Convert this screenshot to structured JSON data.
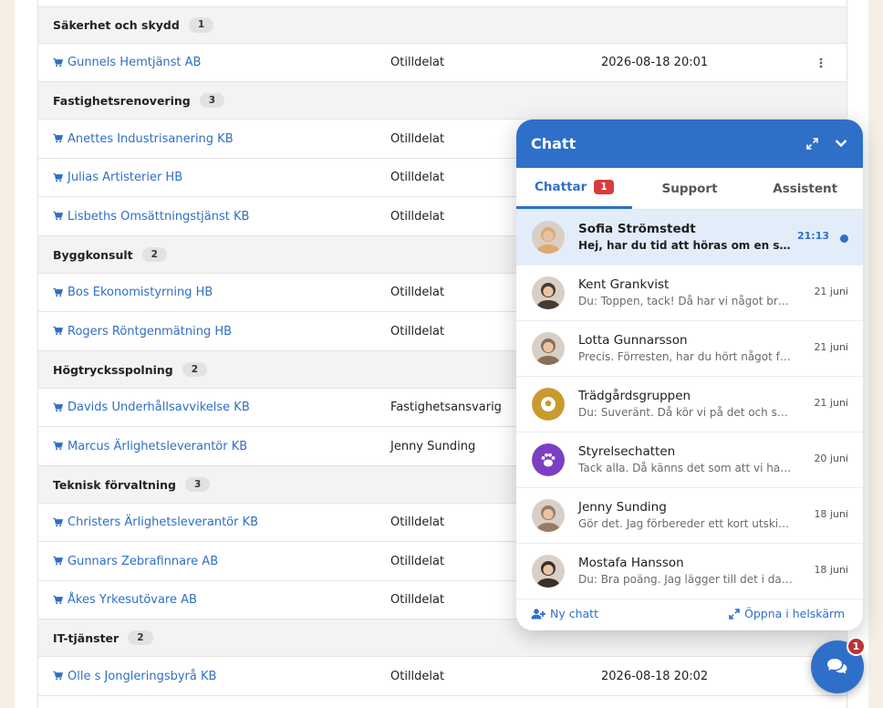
{
  "table": {
    "rows": [
      {
        "kind": "group",
        "name": "Säkerhet och skydd",
        "count": "1"
      },
      {
        "kind": "item",
        "company": "Gunnels Hemtjänst AB",
        "assignee": "Otilldelat",
        "date": "2026-08-18 20:01",
        "menu": true
      },
      {
        "kind": "group",
        "name": "Fastighetsrenovering",
        "count": "3"
      },
      {
        "kind": "item",
        "company": "Anettes Industrisanering KB",
        "assignee": "Otilldelat",
        "date": ""
      },
      {
        "kind": "item",
        "company": "Julias Artisterier HB",
        "assignee": "Otilldelat",
        "date": ""
      },
      {
        "kind": "item",
        "company": "Lisbeths Omsättningstjänst KB",
        "assignee": "Otilldelat",
        "date": ""
      },
      {
        "kind": "group",
        "name": "Byggkonsult",
        "count": "2"
      },
      {
        "kind": "item",
        "company": "Bos Ekonomistyrning HB",
        "assignee": "Otilldelat",
        "date": ""
      },
      {
        "kind": "item",
        "company": "Rogers Röntgenmätning HB",
        "assignee": "Otilldelat",
        "date": ""
      },
      {
        "kind": "group",
        "name": "Högtrycksspolning",
        "count": "2"
      },
      {
        "kind": "item",
        "company": "Davids Underhållsavvikelse KB",
        "assignee": "Fastighetsansvarig",
        "date": ""
      },
      {
        "kind": "item",
        "company": "Marcus Ärlighetsleverantör KB",
        "assignee": "Jenny Sunding",
        "date": ""
      },
      {
        "kind": "group",
        "name": "Teknisk förvaltning",
        "count": "3"
      },
      {
        "kind": "item",
        "company": "Christers Ärlighetsleverantör KB",
        "assignee": "Otilldelat",
        "date": ""
      },
      {
        "kind": "item",
        "company": "Gunnars Zebrafinnare AB",
        "assignee": "Otilldelat",
        "date": ""
      },
      {
        "kind": "item",
        "company": "Åkes Yrkesutövare AB",
        "assignee": "Otilldelat",
        "date": ""
      },
      {
        "kind": "group",
        "name": "IT-tjänster",
        "count": "2"
      },
      {
        "kind": "item",
        "company": "Olle s Jongleringsbyrå KB",
        "assignee": "Otilldelat",
        "date": "2026-08-18 20:02"
      }
    ]
  },
  "chat": {
    "title": "Chatt",
    "tabs": [
      {
        "label": "Chattar",
        "badge": "1"
      },
      {
        "label": "Support",
        "badge": ""
      },
      {
        "label": "Assistent",
        "badge": ""
      }
    ],
    "conversations": [
      {
        "name": "Sofia Strömstedt",
        "message": "Hej, har du tid att höras om en stund?",
        "time": "21:13",
        "unread": true,
        "avatar": "photo-woman-blonde",
        "color": "#e0a96d"
      },
      {
        "name": "Kent Grankvist",
        "message": "Du: Toppen, tack! Då har vi något bra att utgå ifrån.",
        "time": "21 juni",
        "unread": false,
        "avatar": "photo-man-dark",
        "color": "#4a3b2f"
      },
      {
        "name": "Lotta Gunnarsson",
        "message": "Precis. Förresten, har du hört något från styrelsen?",
        "time": "21 juni",
        "unread": false,
        "avatar": "photo-woman-brown",
        "color": "#8b6e57"
      },
      {
        "name": "Trädgårdsgruppen",
        "message": "Du: Suveränt. Då kör vi på det och ser hur det går.",
        "time": "21 juni",
        "unread": false,
        "avatar": "football-icon",
        "color": "#c99a2e"
      },
      {
        "name": "Styrelsechatten",
        "message": "Tack alla. Då känns det som att vi har en plan.",
        "time": "20 juni",
        "unread": false,
        "avatar": "paw-icon",
        "color": "#7c3fc4"
      },
      {
        "name": "Jenny Sunding",
        "message": "Gör det. Jag förbereder ett kort utskick till alla.",
        "time": "18 juni",
        "unread": false,
        "avatar": "photo-group",
        "color": "#9a7a62"
      },
      {
        "name": "Mostafa Hansson",
        "message": "Du: Bra poäng. Jag lägger till det i dagordningen.",
        "time": "18 juni",
        "unread": false,
        "avatar": "photo-man-beard",
        "color": "#3b3028"
      }
    ],
    "footer": {
      "new_chat": "Ny chatt",
      "fullscreen": "Öppna i helskärm"
    }
  },
  "fab": {
    "badge": "1",
    "icon": "comments-icon"
  }
}
